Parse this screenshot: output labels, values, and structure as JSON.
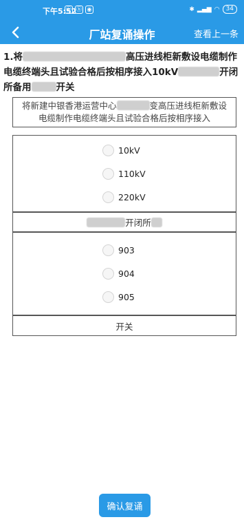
{
  "status_bar": {
    "time": "下午5:52",
    "battery": "34"
  },
  "nav": {
    "title": "厂站复诵操作",
    "action": "查看上一条"
  },
  "question": {
    "prefix": "1.将",
    "middle": "高压进线柜新敷设电缆制作电缆终端头且试验合格后按相序接入10kV",
    "mid2": "开闭所备用",
    "suffix": "开关"
  },
  "sentence": {
    "part1": "将新建中银香港运营中心",
    "part2": "变高压进线柜新敷设电缆制作电缆终端头且试验合格后按相序接入"
  },
  "voltage_options": [
    "10kV",
    "110kV",
    "220kV"
  ],
  "fill_text": "开闭所",
  "number_options": [
    "903",
    "904",
    "905"
  ],
  "switch_text": "开关",
  "confirm_button": "确认复诵"
}
